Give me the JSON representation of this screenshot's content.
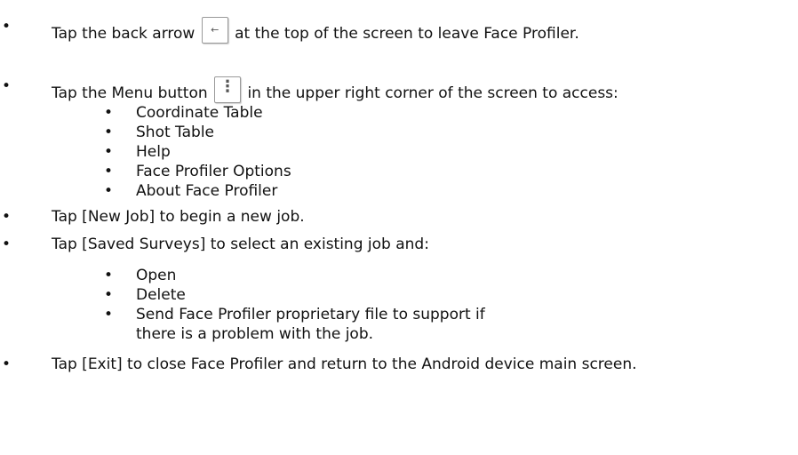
{
  "bullet_char": "•",
  "items": [
    {
      "before": "Tap the back arrow",
      "icon": "back-arrow-icon",
      "after": "at the top of the screen to leave Face Profiler."
    },
    {
      "before": "Tap the Menu button",
      "icon": "menu-icon",
      "after": "in the upper right corner of the screen to access:"
    },
    {
      "sub": [
        "Coordinate Table",
        "Shot Table",
        "Help",
        "Face Profiler Options",
        "About Face Profiler"
      ]
    },
    {
      "text": "Tap [New Job] to begin a new job."
    },
    {
      "text": "Tap [Saved Surveys] to select an existing job and:"
    },
    {
      "sub": [
        "Open",
        "Delete",
        "Send Face Profiler proprietary file to support if",
        "there is a problem with the job."
      ]
    },
    {
      "text": "Tap [Exit] to close Face Profiler and return to the Android device main screen."
    }
  ],
  "icons": {
    "back_glyph": "←",
    "menu_glyph": "⋮"
  }
}
